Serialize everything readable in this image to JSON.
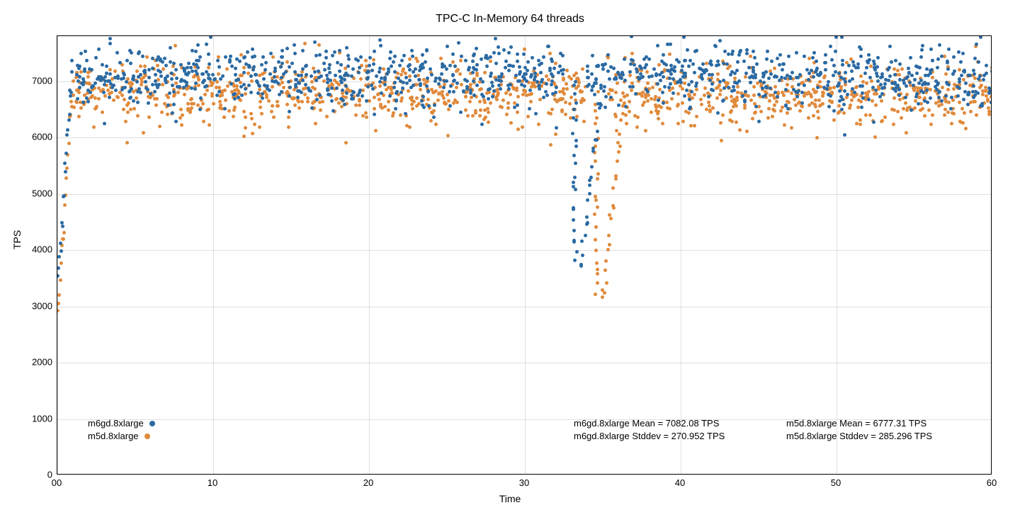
{
  "chart_data": {
    "type": "scatter",
    "title": "TPC-C In-Memory 64 threads",
    "xlabel": "Time",
    "ylabel": "TPS",
    "xlim": [
      0,
      60
    ],
    "ylim": [
      0,
      7800
    ],
    "x_ticks": [
      0,
      10,
      20,
      30,
      40,
      50,
      60
    ],
    "y_ticks": [
      0,
      1000,
      2000,
      3000,
      4000,
      5000,
      6000,
      7000
    ],
    "series": [
      {
        "name": "m6gd.8xlarge",
        "color": "#2b6aa3",
        "mean_tps": 7082.08,
        "stddev_tps": 270.952,
        "band_center": 7082,
        "band_spread": 270,
        "warmup_start_y": 3500,
        "dip_x": 33.2,
        "dip_min_y": 3650
      },
      {
        "name": "m5d.8xlarge",
        "color": "#e08a3c",
        "mean_tps": 6777.31,
        "stddev_tps": 285.296,
        "band_center": 6777,
        "band_spread": 285,
        "warmup_start_y": 2850,
        "dip_x": 34.6,
        "dip_min_y": 3050
      }
    ],
    "legend_entries": [
      "m6gd.8xlarge",
      "m5d.8xlarge"
    ],
    "stats_labels": {
      "m6gd_mean": "m6gd.8xlarge Mean = 7082.08 TPS",
      "m6gd_std": "m6gd.8xlarge Stddev = 270.952 TPS",
      "m5d_mean": "m5d.8xlarge Mean = 6777.31 TPS",
      "m5d_std": "m5d.8xlarge Stddev = 285.296 TPS"
    }
  }
}
